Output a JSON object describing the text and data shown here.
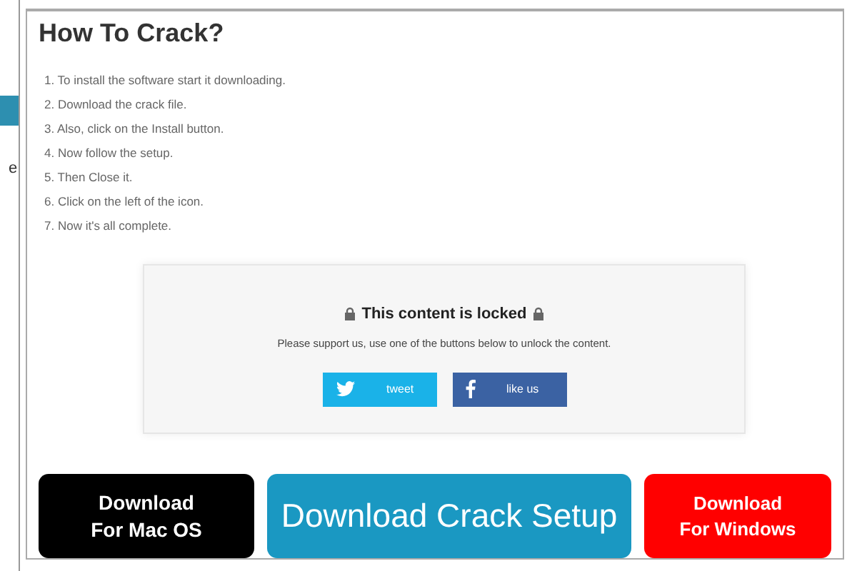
{
  "side_panel": {
    "cut_text": "e"
  },
  "article": {
    "title": "How To Crack?",
    "steps": [
      "1. To install the software start it downloading.",
      "2. Download the crack file.",
      "3. Also, click on the Install button.",
      "4. Now follow the setup.",
      "5. Then Close it.",
      "6. Click on the left of the icon.",
      "7. Now it's all complete."
    ]
  },
  "locker": {
    "title": "This content is locked",
    "message": "Please support us, use one of the buttons below to unlock the content.",
    "buttons": [
      {
        "kind": "twitter",
        "label": "tweet"
      },
      {
        "kind": "facebook",
        "label": "like us"
      }
    ]
  },
  "downloads": [
    {
      "kind": "mac",
      "lines": [
        "Download",
        "For Mac OS"
      ]
    },
    {
      "kind": "crack",
      "lines": [
        "Download Crack Setup"
      ]
    },
    {
      "kind": "windows",
      "lines": [
        "Download",
        "For Windows"
      ]
    }
  ]
}
